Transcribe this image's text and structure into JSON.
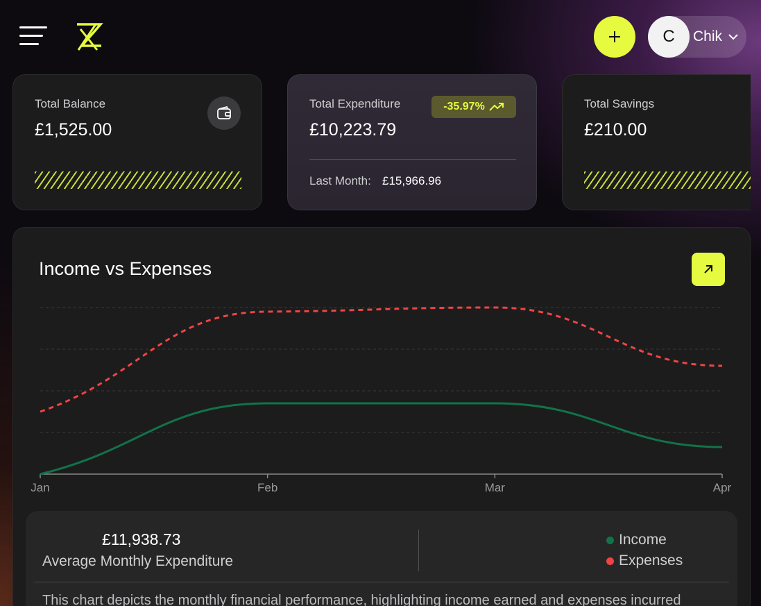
{
  "header": {
    "menu_icon": "hamburger-menu-icon",
    "logo_icon": "brand-logo-icon",
    "add_icon": "plus-icon",
    "user": {
      "avatar_initial": "C",
      "name": "Chik",
      "chevron_icon": "chevron-down-icon"
    }
  },
  "cards": {
    "balance": {
      "label": "Total Balance",
      "value": "£1,525.00",
      "icon": "wallet-icon"
    },
    "expenditure": {
      "label": "Total Expenditure",
      "value": "£10,223.79",
      "badge": "-35.97%",
      "badge_icon": "trend-up-icon",
      "last_month_label": "Last Month:",
      "last_month_value": "£15,966.96"
    },
    "savings": {
      "label": "Total Savings",
      "value": "£210.00"
    }
  },
  "chart_panel": {
    "title": "Income vs Expenses",
    "expand_icon": "arrow-up-right-icon"
  },
  "chart_data": {
    "type": "line",
    "x": [
      "Jan",
      "Feb",
      "Mar",
      "Apr"
    ],
    "series": [
      {
        "name": "Income",
        "color": "#11734a",
        "style": "solid",
        "values": [
          0,
          1700,
          1700,
          650
        ]
      },
      {
        "name": "Expenses",
        "color": "#ef4444",
        "style": "dashed",
        "values": [
          1500,
          3900,
          4000,
          2600
        ]
      }
    ],
    "ylim": [
      0,
      4000
    ],
    "grid": true,
    "title": "Income vs Expenses",
    "xlabel": "",
    "ylabel": ""
  },
  "summary": {
    "avg_value": "£11,938.73",
    "avg_label": "Average Monthly Expenditure",
    "legend": [
      {
        "label": "Income",
        "color": "#11734a"
      },
      {
        "label": "Expenses",
        "color": "#ef4444"
      }
    ],
    "description": "This chart depicts the monthly financial performance, highlighting income earned and expenses incurred"
  },
  "colors": {
    "accent": "#e6fb3f",
    "background": "#0d0a10",
    "card": "#1c1c1d"
  }
}
